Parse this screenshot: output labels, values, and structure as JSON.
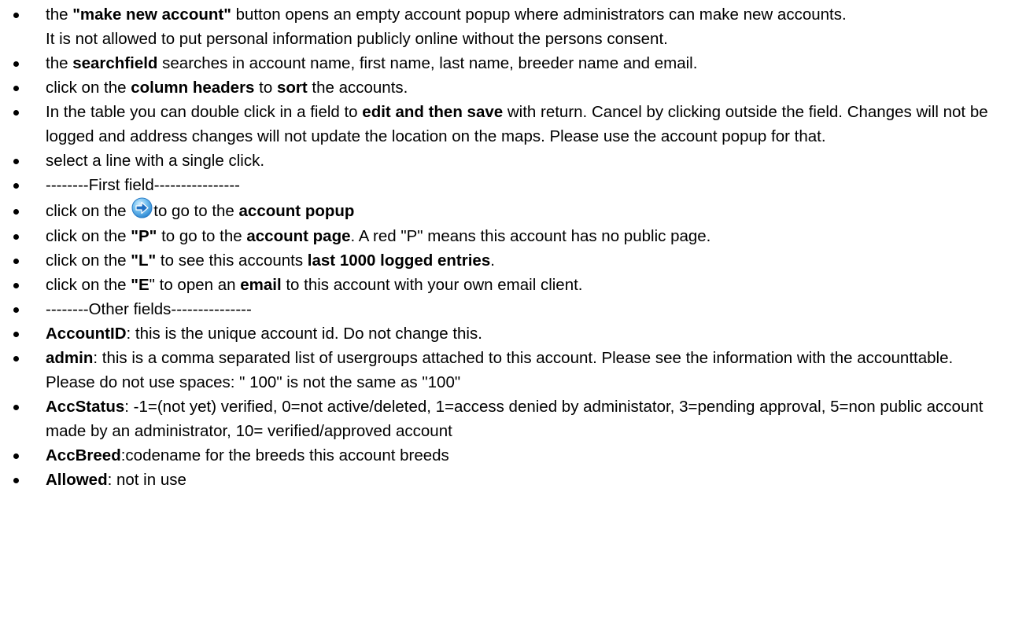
{
  "items": [
    {
      "p1": "the ",
      "b1": "\"make new account\"",
      "p2": " button opens an empty account popup where administrators can make new accounts.",
      "p3": "It is not allowed to put personal information publicly online without the persons consent."
    },
    {
      "p1": "the ",
      "b1": "searchfield",
      "p2": " searches in account name, first name, last name, breeder name and email."
    },
    {
      "p1": "click on the ",
      "b1": "column headers",
      "p2": " to ",
      "b2": "sort",
      "p3": " the accounts."
    },
    {
      "p1": "In the table you can double click in a field to ",
      "b1": "edit and then save",
      "p2": " with return. Cancel by clicking outside the field. Changes will not be logged and address changes will not update the location on the maps. Please use the account popup for that."
    },
    {
      "p1": "select a line with a single click."
    },
    {
      "p1": "--------First field----------------"
    },
    {
      "p1": "click on the ",
      "icon": "blue-arrow-right-icon",
      "p2": "to go to the ",
      "b1": "account popup"
    },
    {
      "p1": "click on the ",
      "b1": "\"P\"",
      "p2": " to go to the ",
      "b2": "account page",
      "p3": ". A red \"P\" means this account has no public page."
    },
    {
      "p1": "click on the ",
      "b1": "\"L\"",
      "p2": " to see this accounts ",
      "b2": "last 1000 logged entries",
      "p3": "."
    },
    {
      "p1": "click on the ",
      "b1": "\"E",
      "p2": "\" to open an ",
      "b2": "email",
      "p3": " to this account with your own email client."
    },
    {
      "p1": "--------Other fields---------------"
    },
    {
      "b1": "AccountID",
      "p1": ": this is the unique account id. Do not change this."
    },
    {
      "b1": "admin",
      "p1": ": this is a comma separated list of usergroups attached to this account. Please see the information with the accounttable. Please do not use spaces: \" 100\" is not the same as \"100\""
    },
    {
      "b1": "AccStatus",
      "p1": ": -1=(not yet) verified, 0=not active/deleted, 1=access denied by administator, 3=pending approval, 5=non public account made by an administrator, 10= verified/approved account"
    },
    {
      "b1": "AccBreed",
      "p1": ":codename for the breeds this account breeds"
    },
    {
      "b1": "Allowed",
      "p1": ": not in use"
    }
  ],
  "colors": {
    "text": "#000000",
    "background": "#ffffff",
    "icon_blue": "#3a9be0"
  }
}
